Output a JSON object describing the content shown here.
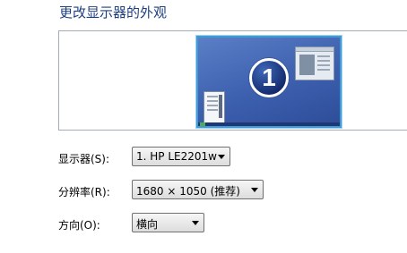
{
  "page": {
    "title": "更改显示器的外观"
  },
  "preview": {
    "monitor_number": "1"
  },
  "settings": {
    "display": {
      "label": "显示器(S):",
      "value": "1. HP LE2201w"
    },
    "resolution": {
      "label": "分辨率(R):",
      "value": "1680 × 1050 (推荐)"
    },
    "orientation": {
      "label": "方向(O):",
      "value": "横向"
    }
  },
  "icons": {
    "dropdown": "chevron-down-icon",
    "monitor": "monitor-preview-icon"
  }
}
